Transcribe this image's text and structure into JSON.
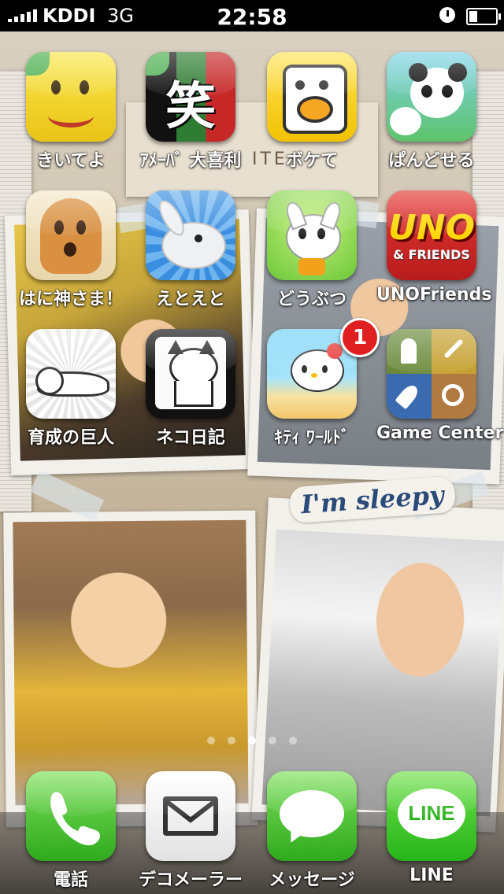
{
  "status_bar": {
    "carrier": "KDDI",
    "network": "3G",
    "time": "22:58"
  },
  "wallpaper": {
    "sticker_text": "I'm sleepy",
    "faint_text": "ITE"
  },
  "apps": [
    {
      "name": "kiiteyo",
      "label": "きいてよ",
      "icon": "yellow-face-icon"
    },
    {
      "name": "ameba-ogiri",
      "label": "ｱﾒｰﾊﾞ 大喜利",
      "icon": "laugh-kanji-icon",
      "glyph": "笑"
    },
    {
      "name": "bokete",
      "label": "ボケて",
      "icon": "bokete-face-icon"
    },
    {
      "name": "panda",
      "label": "ぱんどせる",
      "icon": "panda-icon"
    },
    {
      "name": "haniwa",
      "label": "はに神さま！",
      "icon": "haniwa-icon"
    },
    {
      "name": "etoeto",
      "label": "えとえと",
      "icon": "rabbit-icon"
    },
    {
      "name": "doubutsu",
      "label": "どうぶつ",
      "icon": "white-cat-icon"
    },
    {
      "name": "uno",
      "label": "UNOFriends",
      "icon": "uno-icon",
      "glyph": "UNO",
      "glyph2": "& FRIENDS"
    },
    {
      "name": "giant",
      "label": "育成の巨人",
      "icon": "giant-icon"
    },
    {
      "name": "neko-nikki",
      "label": "ネコ日記",
      "icon": "neko-icon"
    },
    {
      "name": "kitty-world",
      "label": "ｷﾃｨ ﾜｰﾙﾄﾞ",
      "icon": "hello-kitty-icon",
      "badge": "1"
    },
    {
      "name": "game-center",
      "label": "Game Center",
      "icon": "game-center-icon"
    }
  ],
  "dock": [
    {
      "name": "phone",
      "label": "電話",
      "icon": "phone-icon"
    },
    {
      "name": "deco-mailer",
      "label": "デコメーラー",
      "icon": "mail-icon"
    },
    {
      "name": "messages",
      "label": "メッセージ",
      "icon": "speech-bubble-icon"
    },
    {
      "name": "line",
      "label": "LINE",
      "icon": "line-icon",
      "glyph": "LINE"
    }
  ],
  "page_dots": {
    "count": 5,
    "active": 3
  }
}
